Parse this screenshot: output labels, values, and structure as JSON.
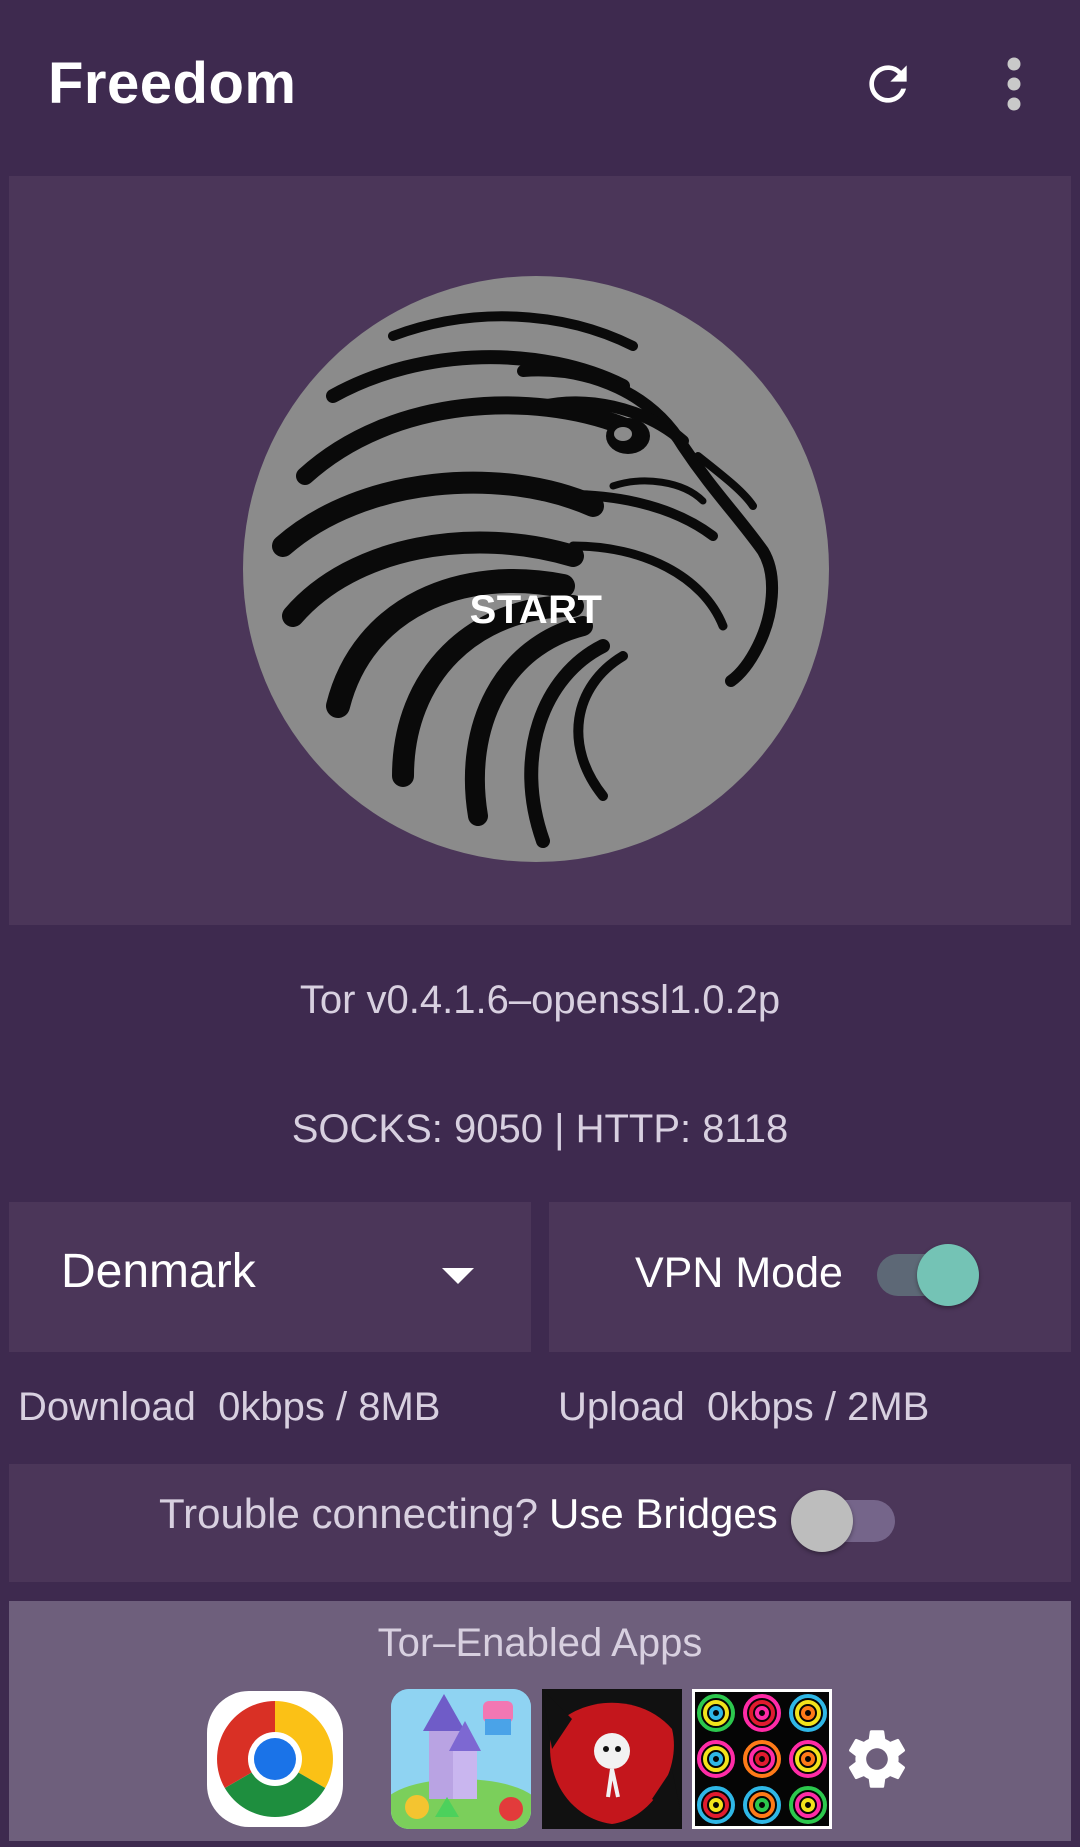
{
  "app": {
    "title": "Freedom"
  },
  "hero": {
    "start_label": "START"
  },
  "status": {
    "tor_version": "Tor v0.4.1.6–openssl1.0.2p",
    "ports": "SOCKS: 9050 | HTTP: 8118"
  },
  "country": {
    "selected": "Denmark"
  },
  "vpn": {
    "label": "VPN Mode",
    "enabled": true
  },
  "traffic": {
    "download_label": "Download",
    "download_value": "0kbps / 8MB",
    "upload_label": "Upload",
    "upload_value": "0kbps / 2MB"
  },
  "bridges": {
    "prompt": "Trouble connecting?",
    "label": "Use Bridges",
    "enabled": false
  },
  "apps": {
    "title": "Tor–Enabled Apps",
    "items": [
      {
        "icon": "chrome-app-icon"
      },
      {
        "icon": "castle-game-app-icon"
      },
      {
        "icon": "red-creature-game-app-icon"
      },
      {
        "icon": "color-rings-game-app-icon"
      }
    ]
  },
  "colors": {
    "background": "#3e2a4f",
    "panel": "#4b3659",
    "apps_panel": "#6e5f7c",
    "start_circle": "#8b8b8b",
    "accent": "#74c3b5"
  }
}
